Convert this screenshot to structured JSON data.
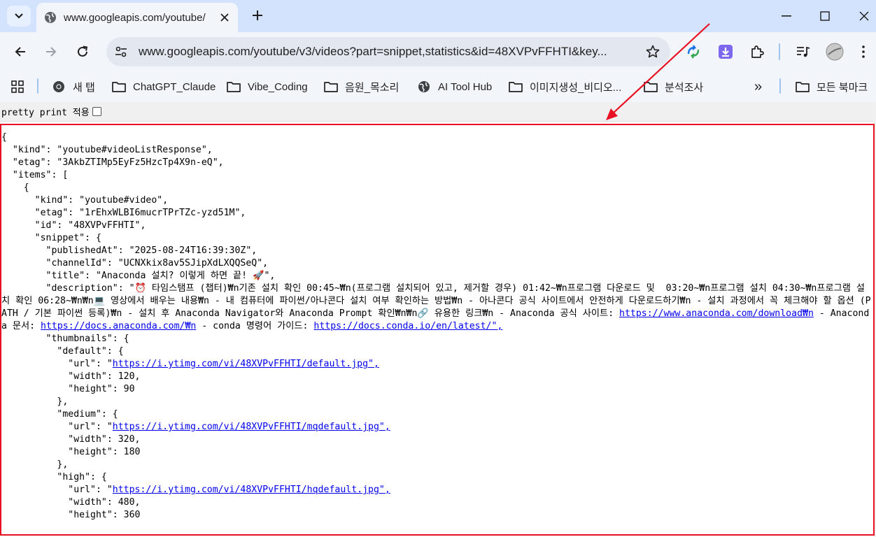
{
  "browser": {
    "tab": {
      "title": "www.googleapis.com/youtube/"
    },
    "address": {
      "url": "www.googleapis.com/youtube/v3/videos?part=snippet,statistics&id=48XVPvFFHTI&key..."
    },
    "bookmarks": [
      {
        "label": "새 탭",
        "icon": "chrome-icon"
      },
      {
        "label": "ChatGPT_Claude",
        "icon": "folder-icon"
      },
      {
        "label": "Vibe_Coding",
        "icon": "folder-icon"
      },
      {
        "label": "음원_목소리",
        "icon": "folder-icon"
      },
      {
        "label": "AI Tool Hub",
        "icon": "globe-icon"
      },
      {
        "label": "이미지생성_비디오...",
        "icon": "folder-icon"
      },
      {
        "label": "분석조사",
        "icon": "folder-icon"
      }
    ],
    "all_bookmarks": "모든 북마크",
    "overflow": "»"
  },
  "page": {
    "pretty_print_label": "pretty print 적용",
    "pretty_print_checked": false,
    "json": {
      "l01": "{",
      "l02": "  \"kind\": \"youtube#videoListResponse\",",
      "l03": "  \"etag\": \"3AkbZTIMp5EyFz5HzcTp4X9n-eQ\",",
      "l04": "  \"items\": [",
      "l05": "    {",
      "l06": "      \"kind\": \"youtube#video\",",
      "l07": "      \"etag\": \"1rEhxWLBI6mucrTPrTZc-yzd51M\",",
      "l08": "      \"id\": \"48XVPvFFHTI\",",
      "l09": "      \"snippet\": {",
      "l10": "        \"publishedAt\": \"2025-08-24T16:39:30Z\",",
      "l11": "        \"channelId\": \"UCNXkix8av5SJipXdLXQQSeQ\",",
      "l12": "        \"title\": \"Anaconda 설치? 이렇게 하면 끝! 🚀\",",
      "desc_prefix": "        \"description\": \"⏰ 타임스탬프 (챕터)₩n기존 설치 확인 00:45~₩n(프로그램 설치되어 있고, 제거할 경우) 01:42~₩n프로그램 다운로드 및  03:20~₩n프로그램 설치 04:30~₩n프로그램 설치 확인 06:28~₩n₩n💻 영상에서 배우는 내용₩n - 내 컴퓨터에 파이썬/아나콘다 설치 여부 확인하는 방법₩n - 아나콘다 공식 사이트에서 안전하게 다운로드하기₩n - 설치 과정에서 꼭 체크해야 할 옵션 (PATH / 기본 파이썬 등록)₩n - 설치 후 Anaconda Navigator와 Anaconda Prompt 확인₩n₩n🔗 유용한 링크₩n - Anaconda 공식 사이트: ",
      "desc_link1": "https://www.anaconda.com/download₩n",
      "desc_mid1": " - Anaconda 문서: ",
      "desc_link2": "https://docs.anaconda.com/₩n",
      "desc_mid2": " - conda 명령어 가이드: ",
      "desc_link3": "https://docs.conda.io/en/latest/\",",
      "l14": "        \"thumbnails\": {",
      "l15": "          \"default\": {",
      "l16_pre": "            \"url\": \"",
      "l16_link": "https://i.ytimg.com/vi/48XVPvFFHTI/default.jpg\",",
      "l17": "            \"width\": 120,",
      "l18": "            \"height\": 90",
      "l19": "          },",
      "l20": "          \"medium\": {",
      "l21_pre": "            \"url\": \"",
      "l21_link": "https://i.ytimg.com/vi/48XVPvFFHTI/mqdefault.jpg\",",
      "l22": "            \"width\": 320,",
      "l23": "            \"height\": 180",
      "l24": "          },",
      "l25": "          \"high\": {",
      "l26_pre": "            \"url\": \"",
      "l26_link": "https://i.ytimg.com/vi/48XVPvFFHTI/hqdefault.jpg\",",
      "l27": "            \"width\": 480,",
      "l28": "            \"height\": 360"
    }
  },
  "colors": {
    "annotation": "#e81123",
    "tabstrip": "#d3e3fd",
    "toolbar": "#f2f5fa",
    "link": "#0000ee"
  }
}
